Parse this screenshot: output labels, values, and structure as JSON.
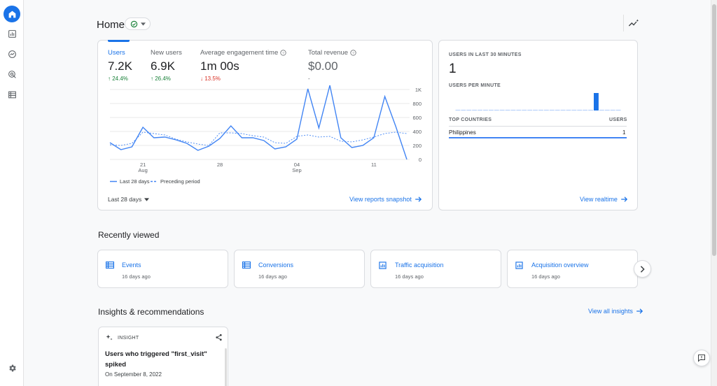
{
  "header": {
    "title": "Home"
  },
  "rail": {
    "items": [
      "home-icon",
      "reports-icon",
      "explore-icon",
      "advertising-icon",
      "configure-icon"
    ],
    "settings_icon": "gear-icon"
  },
  "metrics": [
    {
      "label": "Users",
      "value": "7.2K",
      "change": "24.4%",
      "direction": "up"
    },
    {
      "label": "New users",
      "value": "6.9K",
      "change": "26.4%",
      "direction": "up"
    },
    {
      "label": "Average engagement time",
      "value": "1m 00s",
      "change": "13.5%",
      "direction": "down"
    },
    {
      "label": "Total revenue",
      "value": "$0.00",
      "change": "-",
      "direction": "none"
    }
  ],
  "chart_data": {
    "type": "line",
    "x": [
      "Aug 18",
      "Aug 19",
      "Aug 20",
      "Aug 21",
      "Aug 22",
      "Aug 23",
      "Aug 24",
      "Aug 25",
      "Aug 26",
      "Aug 27",
      "Aug 28",
      "Aug 29",
      "Aug 30",
      "Aug 31",
      "Sep 01",
      "Sep 02",
      "Sep 03",
      "Sep 04",
      "Sep 05",
      "Sep 06",
      "Sep 07",
      "Sep 08",
      "Sep 09",
      "Sep 10",
      "Sep 11",
      "Sep 12",
      "Sep 13",
      "Sep 14",
      "Sep 15"
    ],
    "xticks": [
      {
        "label": "21",
        "sub": "Aug",
        "index": 3
      },
      {
        "label": "28",
        "sub": "",
        "index": 10
      },
      {
        "label": "04",
        "sub": "Sep",
        "index": 17
      },
      {
        "label": "11",
        "sub": "",
        "index": 24
      }
    ],
    "series": [
      {
        "name": "Last 28 days",
        "style": "solid",
        "color": "#4285f4",
        "values": [
          240,
          140,
          180,
          460,
          310,
          320,
          280,
          230,
          130,
          190,
          300,
          480,
          310,
          310,
          270,
          150,
          180,
          290,
          1010,
          450,
          1060,
          310,
          170,
          200,
          310,
          900,
          470,
          0
        ]
      },
      {
        "name": "Preceding period",
        "style": "dashed",
        "color": "#4285f4",
        "values": [
          210,
          200,
          230,
          390,
          370,
          350,
          290,
          250,
          220,
          200,
          380,
          380,
          370,
          340,
          320,
          240,
          230,
          330,
          350,
          320,
          330,
          260,
          250,
          280,
          320,
          370,
          390,
          370
        ]
      }
    ],
    "yticks": [
      "1K",
      "800",
      "600",
      "400",
      "200",
      "0"
    ],
    "ylim": [
      0,
      1000
    ],
    "grid": true,
    "legend": "bottom-left"
  },
  "controls": {
    "date_range": "Last 28 days",
    "view_snapshot": "View reports snapshot"
  },
  "realtime": {
    "users_30_label": "USERS IN LAST 30 MINUTES",
    "users_30_value": "1",
    "per_minute_label": "USERS PER MINUTE",
    "per_minute_values": [
      0,
      0,
      0,
      0,
      0,
      0,
      0,
      0,
      0,
      0,
      0,
      0,
      0,
      0,
      0,
      0,
      0,
      0,
      0,
      0,
      0,
      0,
      0,
      0,
      0,
      1,
      0,
      0,
      0,
      0
    ],
    "top_countries_label": "TOP COUNTRIES",
    "users_col_label": "USERS",
    "countries": [
      {
        "name": "Philippines",
        "users": "1"
      }
    ],
    "view_realtime": "View realtime"
  },
  "recently_viewed": {
    "title": "Recently viewed",
    "items": [
      {
        "title": "Events",
        "time": "16 days ago",
        "icon": "table-icon"
      },
      {
        "title": "Conversions",
        "time": "16 days ago",
        "icon": "table-icon"
      },
      {
        "title": "Traffic acquisition",
        "time": "16 days ago",
        "icon": "bar-chart-icon"
      },
      {
        "title": "Acquisition overview",
        "time": "16 days ago",
        "icon": "bar-chart-icon"
      }
    ]
  },
  "insights": {
    "title": "Insights & recommendations",
    "view_all": "View all insights",
    "card": {
      "badge": "INSIGHT",
      "title": "Users who triggered \"first_visit\" spiked",
      "date": "On September 8, 2022"
    }
  }
}
